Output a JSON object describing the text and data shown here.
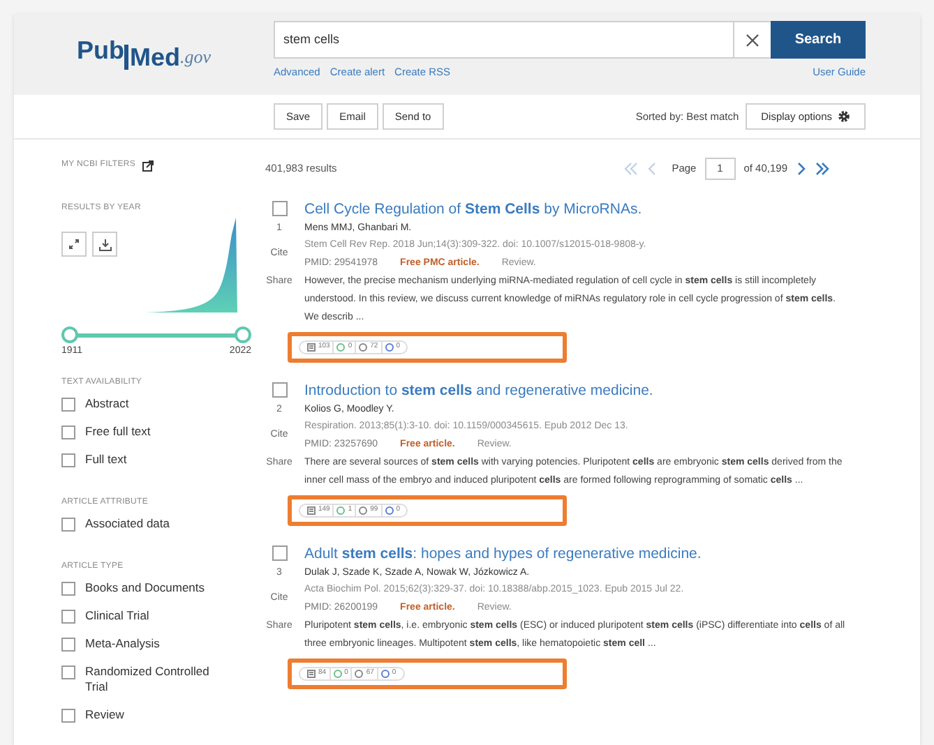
{
  "header": {
    "logo": {
      "main": "Pub",
      "accent": "Med",
      ".gov": ".gov"
    },
    "search": {
      "value": "stem cells",
      "button": "Search"
    },
    "links": [
      "Advanced",
      "Create alert",
      "Create RSS"
    ],
    "user_guide": "User Guide"
  },
  "toolbar": {
    "buttons": [
      "Save",
      "Email",
      "Send to"
    ],
    "sort": "Sorted by: Best match",
    "display_options": "Display options"
  },
  "sidebar": {
    "my_filters": "MY NCBI FILTERS",
    "results_by_year": "RESULTS BY YEAR",
    "year_range": {
      "from": "1911",
      "to": "2022"
    },
    "groups": [
      {
        "heading": "TEXT AVAILABILITY",
        "items": [
          {
            "label": "Abstract",
            "checked": false
          },
          {
            "label": "Free full text",
            "checked": false
          },
          {
            "label": "Full text",
            "checked": false
          }
        ]
      },
      {
        "heading": "ARTICLE ATTRIBUTE",
        "items": [
          {
            "label": "Associated data",
            "checked": false
          }
        ]
      },
      {
        "heading": "ARTICLE TYPE",
        "items": [
          {
            "label": "Books and Documents",
            "checked": false
          },
          {
            "label": "Clinical Trial",
            "checked": false
          },
          {
            "label": "Meta-Analysis",
            "checked": false
          },
          {
            "label": "Randomized Controlled Trial",
            "checked": false
          },
          {
            "label": "Review",
            "checked": false
          }
        ]
      }
    ]
  },
  "results_count": "401,983 results",
  "pagination": {
    "label": "Page",
    "page": "1",
    "of": "of 40,199"
  },
  "results": [
    {
      "number": "1",
      "title": "Cell Cycle Regulation of **Stem Cells** by MicroRNAs.",
      "authors": "Mens MMJ, Ghanbari M.",
      "citation": "Stem Cell Rev Rep. 2018 Jun;14(3):309-322. doi: 10.1007/s12015-018-9808-y.",
      "pmid": "PMID: 29541978",
      "free": "Free PMC article.",
      "type": "Review.",
      "snippet": "However, the precise mechanism underlying miRNA-mediated regulation of cell cycle in **stem cells** is still incompletely understood. In this review, we discuss current knowledge of miRNAs regulatory role in cell cycle progression of **stem cells**. We describ ...",
      "checked": false,
      "highlighted": true,
      "metrics": [
        "103",
        "0",
        "72",
        "0"
      ],
      "actions": [
        "Cite",
        "Share"
      ]
    },
    {
      "number": "2",
      "title": "Introduction to **stem cells** and regenerative medicine.",
      "authors": "Kolios G, Moodley Y.",
      "citation": "Respiration. 2013;85(1):3-10. doi: 10.1159/000345615. Epub 2012 Dec 13.",
      "pmid": "PMID: 23257690",
      "free": "Free article.",
      "type": "Review.",
      "snippet": "There are several sources of **stem cells** with varying potencies. Pluripotent **cells** are embryonic **stem cells** derived from the inner cell mass of the embryo and induced pluripotent **cells** are formed following reprogramming of somatic **cells** ...",
      "checked": false,
      "highlighted": true,
      "metrics": [
        "149",
        "1",
        "99",
        "0"
      ],
      "actions": [
        "Cite",
        "Share"
      ]
    },
    {
      "number": "3",
      "title": "Adult **stem cells**: hopes and hypes of regenerative medicine.",
      "authors": "Dulak J, Szade K, Szade A, Nowak W, Józkowicz A.",
      "citation": "Acta Biochim Pol. 2015;62(3):329-37. doi: 10.18388/abp.2015_1023. Epub 2015 Jul 22.",
      "pmid": "PMID: 26200199",
      "free": "Free article.",
      "type": "Review.",
      "snippet": "Pluripotent **stem cells**, i.e. embryonic **stem cells** (ESC) or induced pluripotent **stem cells** (iPSC) differentiate into **cells** of all three embryonic lineages. Multipotent **stem cells**, like hematopoietic **stem cell** ...",
      "checked": false,
      "highlighted": true,
      "metrics": [
        "84",
        "0",
        "67",
        "0"
      ],
      "actions": [
        "Cite",
        "Share"
      ]
    }
  ]
}
